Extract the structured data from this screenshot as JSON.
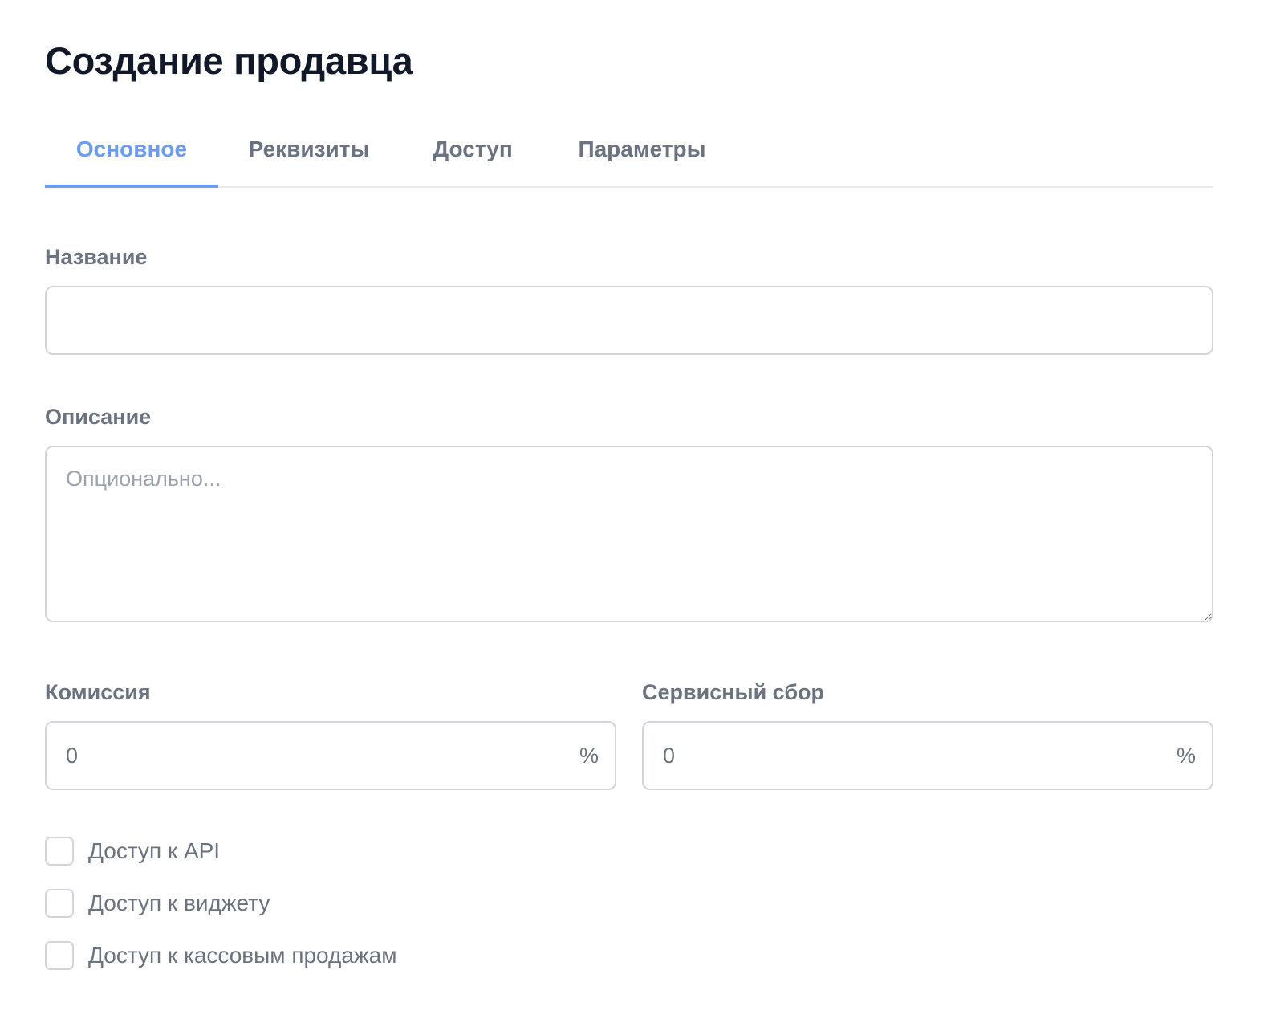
{
  "page": {
    "title": "Создание продавца"
  },
  "tabs": [
    {
      "label": "Основное",
      "active": true
    },
    {
      "label": "Реквизиты",
      "active": false
    },
    {
      "label": "Доступ",
      "active": false
    },
    {
      "label": "Параметры",
      "active": false
    }
  ],
  "form": {
    "name": {
      "label": "Название",
      "value": "",
      "placeholder": ""
    },
    "description": {
      "label": "Описание",
      "value": "",
      "placeholder": "Опционально..."
    },
    "commission": {
      "label": "Комиссия",
      "value": "0",
      "suffix": "%"
    },
    "service_fee": {
      "label": "Сервисный сбор",
      "value": "0",
      "suffix": "%"
    },
    "checkboxes": [
      {
        "label": "Доступ к API",
        "checked": false
      },
      {
        "label": "Доступ к виджету",
        "checked": false
      },
      {
        "label": "Доступ к кассовым продажам",
        "checked": false
      }
    ]
  },
  "colors": {
    "accent": "#6b9cf0",
    "text_primary": "#111827",
    "text_muted": "#6b7280",
    "border": "#d1d5db"
  }
}
